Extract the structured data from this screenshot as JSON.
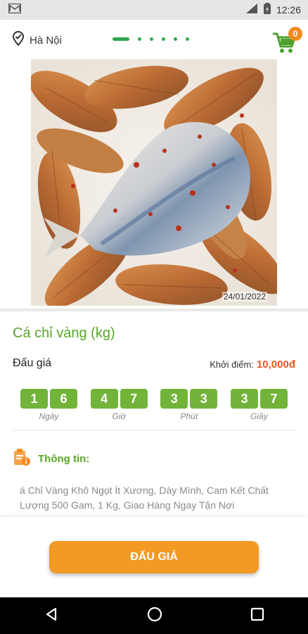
{
  "status_bar": {
    "time": "12:26"
  },
  "header": {
    "location": "Hà Nội",
    "cart_count": "0"
  },
  "product": {
    "image_date": "24/01/2022",
    "name": "Cá chỉ vàng (kg)",
    "auction_label": "Đấu giá",
    "start_price_label": "Khởi điểm:",
    "start_price": "10,000đ"
  },
  "countdown": [
    {
      "digits": [
        "1",
        "6"
      ],
      "label": "Ngày"
    },
    {
      "digits": [
        "4",
        "7"
      ],
      "label": "Giờ"
    },
    {
      "digits": [
        "3",
        "3"
      ],
      "label": "Phút"
    },
    {
      "digits": [
        "3",
        "7"
      ],
      "label": "Giây"
    }
  ],
  "info": {
    "title": "Thông tin:",
    "description": "á Chỉ Vàng Khô Ngọt Ít Xương, Dày Mình, Cam Kết Chất Lượng 500 Gam, 1 Kg, Giao Hàng Ngay Tận Nơi"
  },
  "action": {
    "bid_label": "ĐẤU GIÁ"
  },
  "colors": {
    "accent_green": "#5aa52b",
    "orange": "#f39a25",
    "price_red": "#e8561b"
  }
}
